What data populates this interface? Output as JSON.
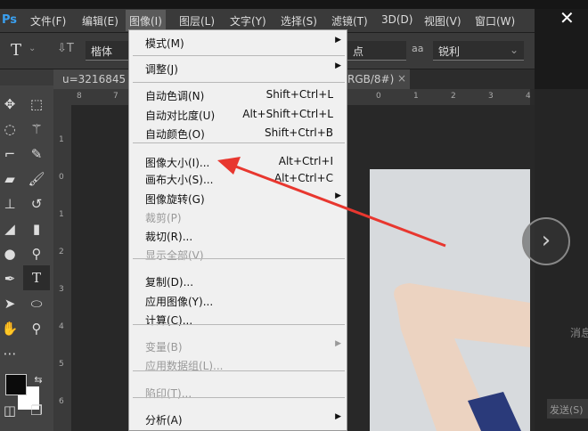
{
  "app": {
    "logo": "Ps",
    "close": "✕"
  },
  "menubar": [
    "文件(F)",
    "编辑(E)",
    "图像(I)",
    "图层(L)",
    "文字(Y)",
    "选择(S)",
    "滤镜(T)",
    "3D(D)",
    "视图(V)",
    "窗口(W)"
  ],
  "options": {
    "tool": "T",
    "font": "楷体",
    "unit_suffix": "点",
    "aa_icon": "aa",
    "antialias": "锐利"
  },
  "tab": {
    "title": "u=3216845",
    "suffix": "RGB/8#)",
    "close": "×"
  },
  "hruler": [
    "8",
    "7",
    "0",
    "1",
    "2",
    "3",
    "4"
  ],
  "vruler": [
    "1",
    "0",
    "1",
    "2",
    "3",
    "4",
    "5",
    "6"
  ],
  "menu": [
    {
      "label": "模式(M)",
      "submenu": true
    },
    {
      "sep": true
    },
    {
      "label": "调整(J)",
      "submenu": true
    },
    {
      "sep": true
    },
    {
      "label": "自动色调(N)",
      "shortcut": "Shift+Ctrl+L"
    },
    {
      "label": "自动对比度(U)",
      "shortcut": "Alt+Shift+Ctrl+L"
    },
    {
      "label": "自动颜色(O)",
      "shortcut": "Shift+Ctrl+B"
    },
    {
      "sep": true
    },
    {
      "label": "图像大小(I)...",
      "shortcut": "Alt+Ctrl+I"
    },
    {
      "label": "画布大小(S)...",
      "shortcut": "Alt+Ctrl+C"
    },
    {
      "label": "图像旋转(G)",
      "submenu": true
    },
    {
      "label": "裁剪(P)",
      "disabled": true
    },
    {
      "label": "裁切(R)..."
    },
    {
      "label": "显示全部(V)",
      "disabled": true
    },
    {
      "sep": true
    },
    {
      "label": "复制(D)..."
    },
    {
      "label": "应用图像(Y)..."
    },
    {
      "label": "计算(C)..."
    },
    {
      "sep": true
    },
    {
      "label": "变量(B)",
      "disabled": true,
      "submenu": true
    },
    {
      "label": "应用数据组(L)...",
      "disabled": true
    },
    {
      "sep": true
    },
    {
      "label": "陷印(T)...",
      "disabled": true
    },
    {
      "sep": true
    },
    {
      "label": "分析(A)",
      "submenu": true
    }
  ],
  "side": {
    "message": "消息",
    "send": "发送(S)",
    "next": "›"
  },
  "colors": {
    "arrow": "#e8372f",
    "menu_bg": "#f0f0f0"
  }
}
